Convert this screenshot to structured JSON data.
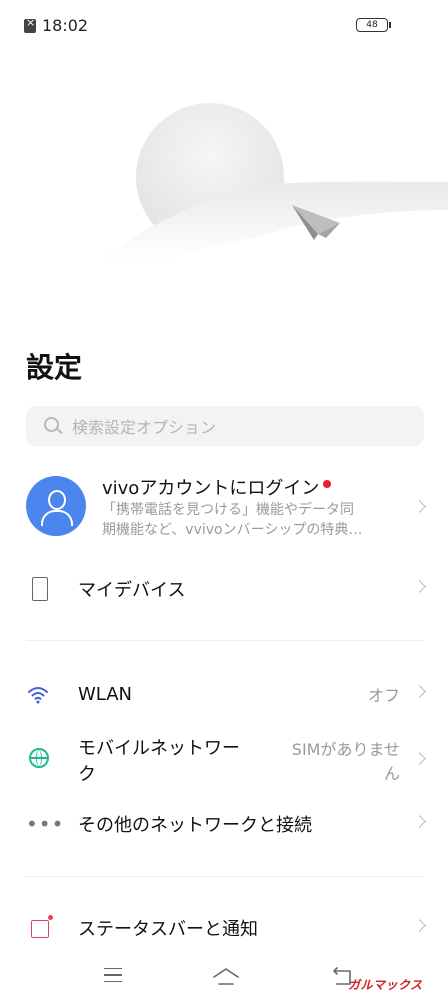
{
  "status_bar": {
    "time": "18:02",
    "battery": "48"
  },
  "page": {
    "title": "設定"
  },
  "search": {
    "placeholder": "検索設定オプション"
  },
  "account": {
    "title": "vivoアカウントにログイン",
    "subtitle_line1": "「携帯電話を見つける」機能やデータ同",
    "subtitle_line2": "期機能など、vvivoンバーシップの特典…"
  },
  "settings": {
    "my_device": "マイデバイス",
    "wlan": {
      "label": "WLAN",
      "value": "オフ"
    },
    "mobile_network": {
      "label_line1": "モバイルネットワー",
      "label_line2": "ク",
      "value_line1": "SIMがありませ",
      "value_line2": "ん"
    },
    "other_network": "その他のネットワークと接続",
    "status_bar_notifications": "ステータスバーと通知"
  },
  "watermark": "ガルマックス",
  "colors": {
    "accent_blue": "#4a86ee",
    "wlan_icon": "#3f61d8",
    "network_icon": "#1fb98c",
    "status_icon": "#e04257",
    "notification_dot": "#e8202a"
  },
  "icons": [
    "sim-off-icon",
    "battery-icon",
    "search-icon",
    "avatar-icon",
    "device-icon",
    "wifi-icon",
    "globe-icon",
    "more-dots-icon",
    "status-bar-icon",
    "chevron-right-icon",
    "menu-icon",
    "home-icon",
    "back-icon"
  ]
}
